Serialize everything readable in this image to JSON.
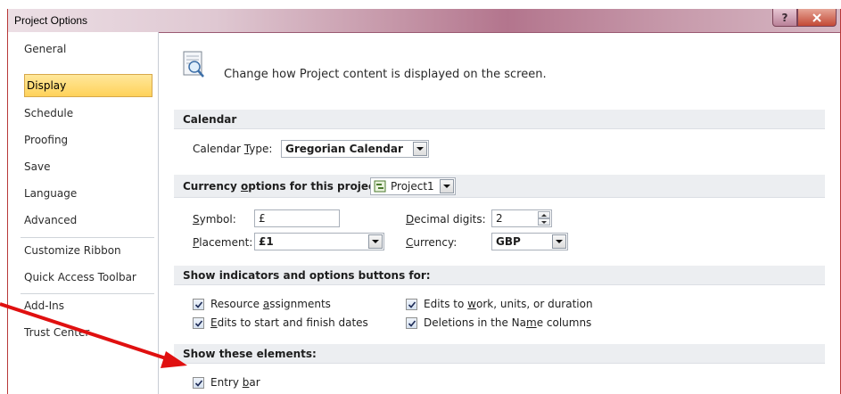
{
  "window": {
    "title": "Project Options",
    "help_label": "?",
    "close_label": "x"
  },
  "sidebar": {
    "items": [
      {
        "label": "General"
      },
      {
        "label": "Display"
      },
      {
        "label": "Schedule"
      },
      {
        "label": "Proofing"
      },
      {
        "label": "Save"
      },
      {
        "label": "Language"
      },
      {
        "label": "Advanced"
      },
      {
        "label": "Customize Ribbon"
      },
      {
        "label": "Quick Access Toolbar"
      },
      {
        "label": "Add-Ins"
      },
      {
        "label": "Trust Center"
      }
    ],
    "selected": "Display"
  },
  "header": {
    "icon": "display-settings-icon",
    "text": "Change how Project content is displayed on the screen."
  },
  "calendar": {
    "section_title": "Calendar",
    "type_label_pre": "Calendar ",
    "type_label_accel": "T",
    "type_label_post": "ype:",
    "type_value": "Gregorian Calendar"
  },
  "currency": {
    "section_title_pre": "Currency ",
    "section_title_accel": "o",
    "section_title_post": "ptions for this project:",
    "project_value": "Project1",
    "symbol_label_accel": "S",
    "symbol_label_post": "ymbol:",
    "symbol_value": "£",
    "placement_label_accel": "P",
    "placement_label_post": "lacement:",
    "placement_value": "£1",
    "decimal_label_accel": "D",
    "decimal_label_post": "ecimal digits:",
    "decimal_value": "2",
    "currency_label_accel": "C",
    "currency_label_post": "urrency:",
    "currency_value": "GBP"
  },
  "indicators": {
    "section_title": "Show indicators and options buttons for:",
    "resource_pre": "Resource ",
    "resource_accel": "a",
    "resource_post": "ssignments",
    "edits_start_accel": "E",
    "edits_start_post": "dits to start and finish dates",
    "edits_work_pre": "Edits to ",
    "edits_work_accel": "w",
    "edits_work_post": "ork, units, or duration",
    "deletions_pre": "Deletions in the Na",
    "deletions_accel": "m",
    "deletions_post": "e columns",
    "checked": [
      true,
      true,
      true,
      true
    ]
  },
  "elements": {
    "section_title": "Show these elements:",
    "entry_bar_pre": "Entry ",
    "entry_bar_accel": "b",
    "entry_bar_post": "ar",
    "entry_bar_checked": true
  },
  "annotation": {
    "arrow_color": "#e01010"
  },
  "colors": {
    "selected_nav": "#ffd25a",
    "section_bg": "#eceef1",
    "window_border": "#b83838"
  }
}
